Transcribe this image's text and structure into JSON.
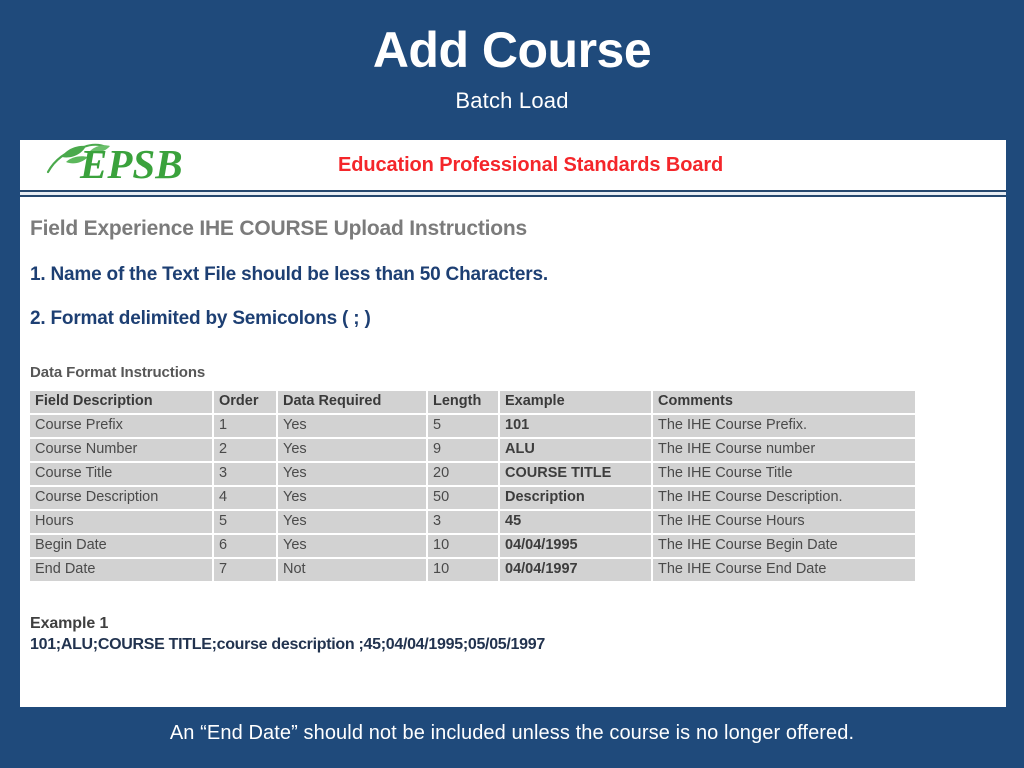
{
  "slide": {
    "title": "Add Course",
    "subtitle": "Batch Load",
    "footer_note": "An “End Date” should not be included unless the course is no longer offered.",
    "background_color": "#1f4a7b"
  },
  "document": {
    "logo": {
      "wordmark": "EPSB",
      "wordmark_color": "#3aa23c",
      "leaf_icon": "leaf-branch-icon"
    },
    "org_title": "Education Professional Standards Board",
    "org_title_color": "#f4262a",
    "heading": "Field Experience IHE COURSE Upload Instructions",
    "steps": [
      "1. Name of the Text File should be less than 50 Characters.",
      "2. Format delimited by Semicolons ( ; )"
    ],
    "table_caption": "Data Format Instructions",
    "table": {
      "columns": [
        "Field Description",
        "Order",
        "Data Required",
        "Length",
        "Example",
        "Comments"
      ],
      "rows": [
        {
          "field": "Course Prefix",
          "order": "1",
          "required": "Yes",
          "length": "5",
          "example": "101",
          "comment": "The IHE Course Prefix."
        },
        {
          "field": "Course Number",
          "order": "2",
          "required": "Yes",
          "length": "9",
          "example": "ALU",
          "comment": "The IHE Course number"
        },
        {
          "field": "Course Title",
          "order": "3",
          "required": "Yes",
          "length": "20",
          "example": "COURSE TITLE",
          "comment": "The IHE Course Title"
        },
        {
          "field": "Course Description",
          "order": "4",
          "required": "Yes",
          "length": "50",
          "example": "Description",
          "comment": "The IHE Course Description."
        },
        {
          "field": "Hours",
          "order": "5",
          "required": "Yes",
          "length": "3",
          "example": "45",
          "comment": "The IHE Course Hours"
        },
        {
          "field": "Begin Date",
          "order": "6",
          "required": "Yes",
          "length": "10",
          "example": "04/04/1995",
          "comment": "The IHE Course Begin Date"
        },
        {
          "field": "End Date",
          "order": "7",
          "required": "Not",
          "length": "10",
          "example": "04/04/1997",
          "comment": "The IHE Course End Date"
        }
      ]
    },
    "example": {
      "label": "Example 1",
      "line": "101;ALU;COURSE TITLE;course description ;45;04/04/1995;05/05/1997"
    }
  }
}
